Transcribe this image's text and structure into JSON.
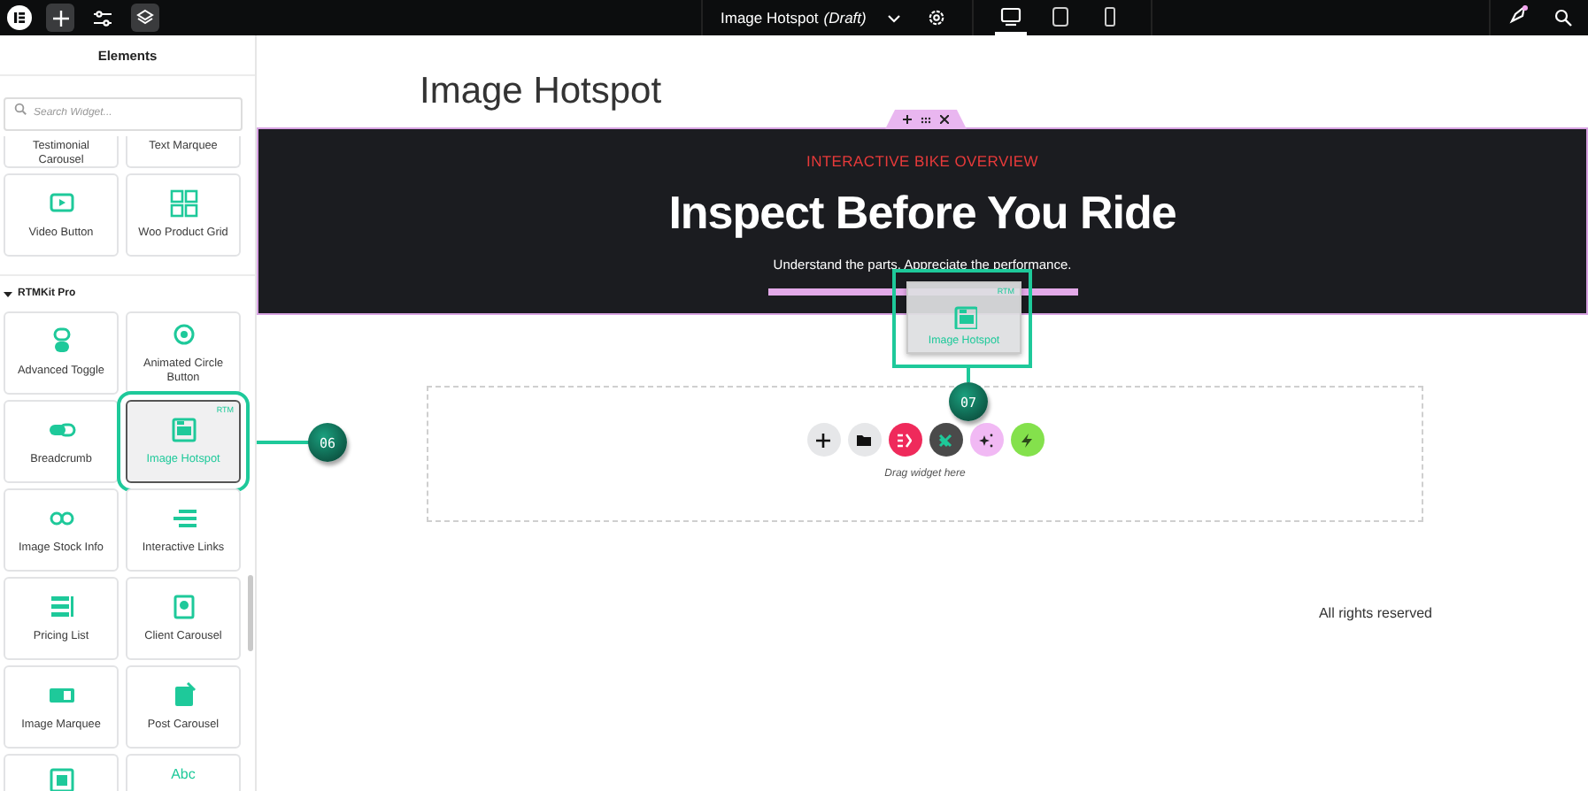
{
  "topbar": {
    "page_title": "Image Hotspot",
    "page_status": "(Draft)",
    "devices": [
      {
        "kind": "desktop",
        "selected": true
      },
      {
        "kind": "tablet",
        "selected": false
      },
      {
        "kind": "mobile",
        "selected": false
      }
    ]
  },
  "panel": {
    "title": "Elements",
    "search": {
      "placeholder": "Search Widget..."
    },
    "sections": [
      {
        "widgets": [
          {
            "kind": "clipped-top",
            "label": "Testimonial Carousel",
            "selected": false
          },
          {
            "kind": "clipped-top",
            "label": "Text Marquee",
            "selected": false
          },
          {
            "kind": "tile",
            "label": "Video Button",
            "selected": false
          },
          {
            "kind": "tile",
            "label": "Woo Product Grid",
            "selected": false
          }
        ]
      },
      {
        "title": "RTMKit Pro",
        "expanded": true,
        "widgets": [
          {
            "kind": "tile",
            "label": "Advanced Toggle",
            "selected": false
          },
          {
            "kind": "tile",
            "label": "Animated Circle Button",
            "selected": false
          },
          {
            "kind": "tile",
            "label": "Breadcrumb",
            "selected": false
          },
          {
            "kind": "tile",
            "label": "Image Hotspot",
            "selected": true,
            "tag": "RTM"
          },
          {
            "kind": "tile",
            "label": "Image Stock Info",
            "selected": false
          },
          {
            "kind": "tile",
            "label": "Interactive Links",
            "selected": false
          },
          {
            "kind": "tile",
            "label": "Pricing List",
            "selected": false
          },
          {
            "kind": "tile",
            "label": "Client Carousel",
            "selected": false
          },
          {
            "kind": "tile",
            "label": "Image Marquee",
            "selected": false
          },
          {
            "kind": "tile",
            "label": "Post Carousel",
            "selected": false
          },
          {
            "kind": "clipped-bottom",
            "selected": false
          },
          {
            "kind": "clipped-bottom",
            "selected": false,
            "icon_text": "Abc"
          }
        ]
      }
    ]
  },
  "canvas": {
    "page_title": "Image Hotspot",
    "hero": {
      "eyebrow": "INTERACTIVE BIKE OVERVIEW",
      "heading": "Inspect Before You Ride",
      "subtitle": "Understand the parts. Appreciate the performance."
    },
    "drop_zone": {
      "hint": "Drag widget here",
      "buttons": [
        {
          "kind": "add",
          "color": "#e6e7e9"
        },
        {
          "kind": "folder",
          "color": "#e6e7e9"
        },
        {
          "kind": "ek",
          "color": "#ef2a5b"
        },
        {
          "kind": "brand",
          "color": "#4a4a4a"
        },
        {
          "kind": "sparkle",
          "color": "#f1b9f4"
        },
        {
          "kind": "bolt",
          "color": "#84e14c"
        }
      ]
    },
    "footer": "All rights reserved",
    "drag_ghost": {
      "tag": "RTM",
      "label": "Image Hotspot"
    }
  },
  "callouts": [
    {
      "label": "06"
    },
    {
      "label": "07"
    }
  ]
}
